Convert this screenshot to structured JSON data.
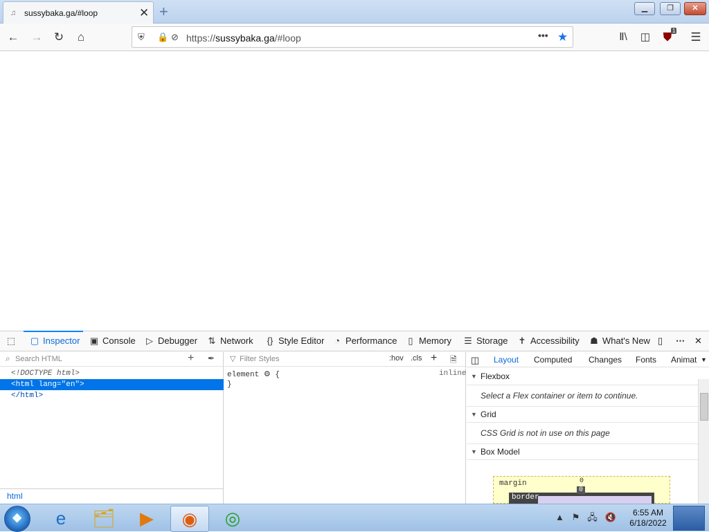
{
  "browser": {
    "tab_title": "sussybaka.ga/#loop",
    "new_tab_symbol": "+",
    "close_tab_symbol": "✕",
    "url_scheme": "https://",
    "url_host": "sussybaka.ga",
    "url_path": "/#loop",
    "page_actions": "•••",
    "extension_badge": "1",
    "window_buttons": {
      "minimize": "▁",
      "restore": "❐",
      "close": "✕"
    },
    "nav_icons": [
      "back-icon",
      "forward-icon",
      "reload-icon",
      "home-icon"
    ],
    "accent_color": "#1a73e8"
  },
  "devtools": {
    "tabs": [
      {
        "label": "Inspector",
        "icon": "inspector-icon",
        "active": true
      },
      {
        "label": "Console",
        "icon": "console-icon"
      },
      {
        "label": "Debugger",
        "icon": "debugger-icon"
      },
      {
        "label": "Network",
        "icon": "network-icon"
      },
      {
        "label": "Style Editor",
        "icon": "style-editor-icon"
      },
      {
        "label": "Performance",
        "icon": "performance-icon"
      },
      {
        "label": "Memory",
        "icon": "memory-icon"
      },
      {
        "label": "Storage",
        "icon": "storage-icon"
      },
      {
        "label": "Accessibility",
        "icon": "accessibility-icon"
      },
      {
        "label": "What's New",
        "icon": "whats-new-icon"
      }
    ],
    "markup": {
      "search_placeholder": "Search HTML",
      "lines": [
        "<!DOCTYPE html>",
        "<html lang=\"en\">",
        "</html>"
      ],
      "selected_index": 1,
      "breadcrumb": "html"
    },
    "rules": {
      "filter_placeholder": "Filter Styles",
      "hov": ":hov",
      "cls": ".cls",
      "selector": "element",
      "open_brace": "{",
      "close_brace": "}",
      "source": "inline"
    },
    "sidebar": {
      "tabs": [
        "Layout",
        "Computed",
        "Changes",
        "Fonts",
        "Animat"
      ],
      "active_tab": "Layout",
      "sections": [
        {
          "title": "Flexbox",
          "body": "Select a Flex container or item to continue."
        },
        {
          "title": "Grid",
          "body": "CSS Grid is not in use on this page"
        },
        {
          "title": "Box Model",
          "body": ""
        }
      ],
      "box_model": {
        "margin_label": "margin",
        "margin_top": "0",
        "border_label": "border",
        "border_top": "0"
      }
    }
  },
  "taskbar": {
    "clock_time": "6:55 AM",
    "clock_date": "6/18/2022",
    "items": [
      "internet-explorer-icon",
      "file-explorer-icon",
      "media-player-icon",
      "firefox-icon",
      "chrome-icon"
    ],
    "active_item": "firefox-icon"
  }
}
